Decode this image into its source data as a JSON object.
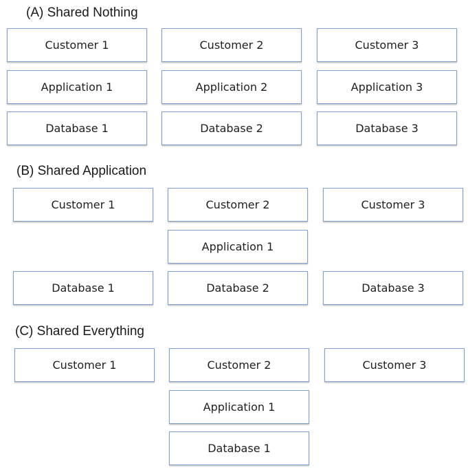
{
  "diagram": {
    "sections": [
      {
        "id": "a",
        "title": "(A) Shared Nothing",
        "boxes": [
          {
            "label": "Customer 1",
            "kind": "customer"
          },
          {
            "label": "Customer 2",
            "kind": "customer"
          },
          {
            "label": "Customer 3",
            "kind": "customer"
          },
          {
            "label": "Application 1",
            "kind": "application"
          },
          {
            "label": "Application 2",
            "kind": "application"
          },
          {
            "label": "Application 3",
            "kind": "application"
          },
          {
            "label": "Database 1",
            "kind": "database"
          },
          {
            "label": "Database 2",
            "kind": "database"
          },
          {
            "label": "Database 3",
            "kind": "database"
          }
        ]
      },
      {
        "id": "b",
        "title": "(B) Shared Application",
        "boxes": [
          {
            "label": "Customer 1",
            "kind": "customer"
          },
          {
            "label": "Customer 2",
            "kind": "customer"
          },
          {
            "label": "Customer 3",
            "kind": "customer"
          },
          {
            "label": "Application 1",
            "kind": "application"
          },
          {
            "label": "Database 1",
            "kind": "database"
          },
          {
            "label": "Database 2",
            "kind": "database"
          },
          {
            "label": "Database 3",
            "kind": "database"
          }
        ]
      },
      {
        "id": "c",
        "title": "(C) Shared Everything",
        "boxes": [
          {
            "label": "Customer 1",
            "kind": "customer"
          },
          {
            "label": "Customer 2",
            "kind": "customer"
          },
          {
            "label": "Customer 3",
            "kind": "customer"
          },
          {
            "label": "Application 1",
            "kind": "application"
          },
          {
            "label": "Database 1",
            "kind": "database"
          }
        ]
      }
    ],
    "colors": {
      "box_border": "#7fa1d2",
      "box_fill": "#ffffff",
      "text": "#1f1f1f"
    }
  }
}
